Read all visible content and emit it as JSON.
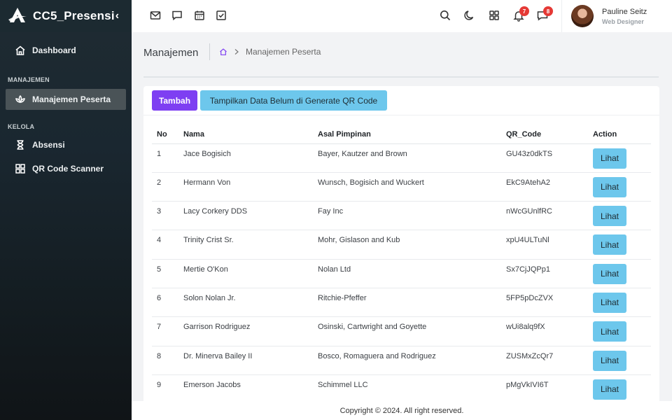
{
  "brand": {
    "name": "CC5_Presensi",
    "toggle_glyph": "‹"
  },
  "sidebar": {
    "dashboard": {
      "label": "Dashboard",
      "icon": "home-icon"
    },
    "section_manajemen": "MANAJEMEN",
    "manajemen_peserta": {
      "label": "Manajemen Peserta",
      "icon": "lotus-icon"
    },
    "section_kelola": "KELOLA",
    "absensi": {
      "label": "Absensi",
      "icon": "hourglass-icon"
    },
    "qr_scanner": {
      "label": "QR Code Scanner",
      "icon": "qr-grid-icon"
    }
  },
  "topbar": {
    "left_icons": [
      "mail-icon",
      "chat-icon",
      "calendar-icon",
      "checkbox-icon"
    ],
    "right_icons": [
      "search-icon",
      "moon-icon",
      "apps-grid-icon",
      "bell-icon",
      "message-icon"
    ],
    "bell_badge": "7",
    "message_badge": "8",
    "profile": {
      "name": "Pauline Seitz",
      "role": "Web Designer"
    }
  },
  "page": {
    "title": "Manajemen",
    "breadcrumb_current": "Manajemen Peserta"
  },
  "card": {
    "tambah_label": "Tambah",
    "qr_filter_label": "Tampilkan Data Belum di Generate QR Code",
    "columns": [
      "No",
      "Nama",
      "Asal Pimpinan",
      "QR_Code",
      "Action"
    ],
    "action_label": "Lihat",
    "rows": [
      [
        "1",
        "Jace Bogisich",
        "Bayer, Kautzer and Brown",
        "GU43z0dkTS"
      ],
      [
        "2",
        "Hermann Von",
        "Wunsch, Bogisich and Wuckert",
        "EkC9AtehA2"
      ],
      [
        "3",
        "Lacy Corkery DDS",
        "Fay Inc",
        "nWcGUnlfRC"
      ],
      [
        "4",
        "Trinity Crist Sr.",
        "Mohr, Gislason and Kub",
        "xpU4ULTuNl"
      ],
      [
        "5",
        "Mertie O'Kon",
        "Nolan Ltd",
        "Sx7CjJQPp1"
      ],
      [
        "6",
        "Solon Nolan Jr.",
        "Ritchie-Pfeffer",
        "5FP5pDcZVX"
      ],
      [
        "7",
        "Garrison Rodriguez",
        "Osinski, Cartwright and Goyette",
        "wUi8alq9fX"
      ],
      [
        "8",
        "Dr. Minerva Bailey II",
        "Bosco, Romaguera and Rodriguez",
        "ZUSMxZcQr7"
      ],
      [
        "9",
        "Emerson Jacobs",
        "Schimmel LLC",
        "pMgVkIVI6T"
      ]
    ]
  },
  "footer": {
    "text": "Copyright © 2024. All right reserved."
  },
  "colors": {
    "primary": "#7e3ff2",
    "info": "#6dc7ec",
    "sidebar": "#1a2730",
    "badge": "#e53935"
  }
}
